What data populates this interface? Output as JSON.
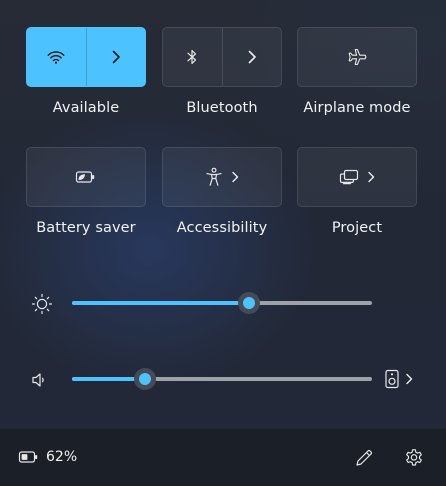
{
  "colors": {
    "accent": "#4cc2ff",
    "panel_bg": "#222836",
    "tile_bg": "#2d323d",
    "footer_bg": "#1b1f28"
  },
  "quick_actions": [
    {
      "label": "Available",
      "icon": "wifi-icon",
      "active": true,
      "has_expand": true
    },
    {
      "label": "Bluetooth",
      "icon": "bluetooth-icon",
      "active": false,
      "has_expand": true
    },
    {
      "label": "Airplane mode",
      "icon": "airplane-icon",
      "active": false,
      "has_expand": false
    },
    {
      "label": "Battery saver",
      "icon": "battery-saver-icon",
      "active": false,
      "has_expand": false
    },
    {
      "label": "Accessibility",
      "icon": "accessibility-icon",
      "active": false,
      "has_expand": true
    },
    {
      "label": "Project",
      "icon": "project-icon",
      "active": false,
      "has_expand": true
    }
  ],
  "brightness": {
    "icon": "brightness-icon",
    "level": 0.59
  },
  "volume": {
    "icon": "speaker-icon",
    "level": 0.243,
    "output_icon": "audio-output-device-icon"
  },
  "footer": {
    "battery_icon": "battery-charging-icon",
    "battery_text": "62%",
    "edit_icon": "pencil-icon",
    "settings_icon": "gear-icon"
  }
}
